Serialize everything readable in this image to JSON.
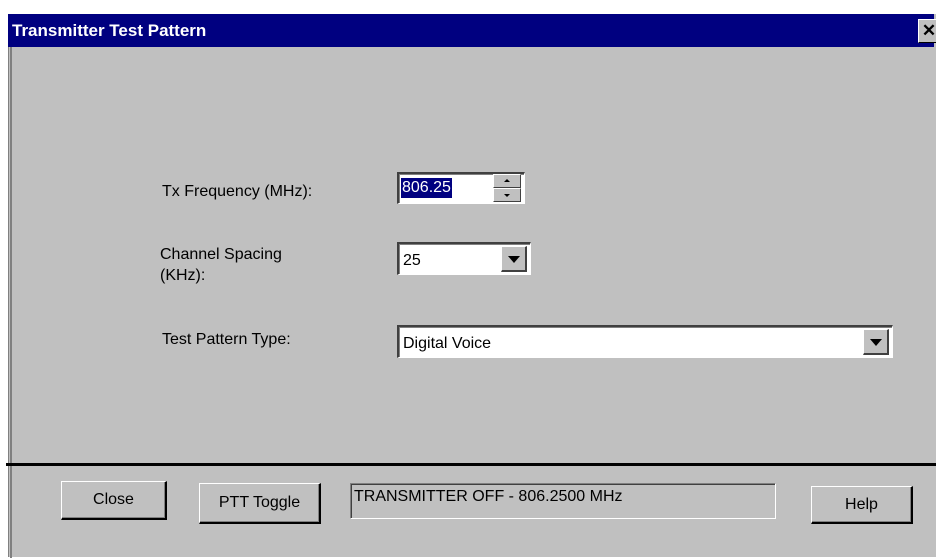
{
  "window": {
    "title": "Transmitter Test Pattern",
    "close_glyph": "✕"
  },
  "fields": {
    "tx_frequency": {
      "label": "Tx Frequency (MHz):",
      "value": "806.25"
    },
    "channel_spacing": {
      "label_line1": "Channel Spacing",
      "label_line2": "(KHz):",
      "value": "25"
    },
    "test_pattern_type": {
      "label": "Test Pattern Type:",
      "value": "Digital Voice"
    }
  },
  "buttons": {
    "close": "Close",
    "ptt_toggle": "PTT Toggle",
    "help": "Help"
  },
  "status": {
    "text": "TRANSMITTER OFF - 806.2500 MHz"
  },
  "icons": {
    "close": "close-icon",
    "spin_up": "spin-up-icon",
    "spin_down": "spin-down-icon",
    "dropdown": "chevron-down-icon"
  },
  "colors": {
    "titlebar": "#000080",
    "face": "#c0c0c0",
    "selection": "#000080"
  }
}
